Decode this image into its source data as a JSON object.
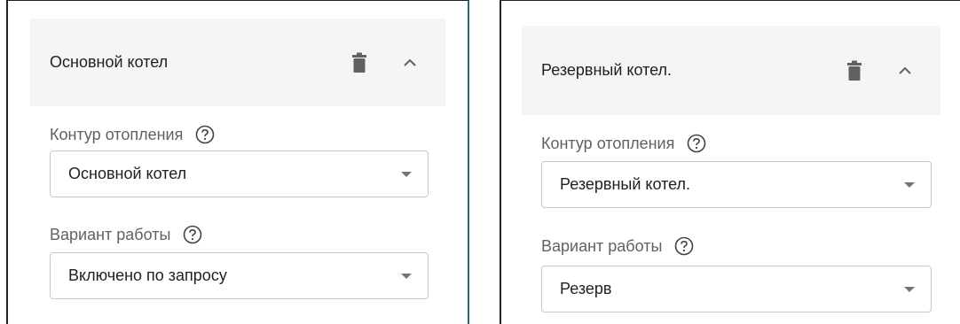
{
  "left_card": {
    "title": "Основной котел",
    "heating_circuit": {
      "label": "Контур отопления",
      "value": "Основной котел"
    },
    "operation_mode": {
      "label": "Вариант работы",
      "value": "Включено по запросу"
    }
  },
  "right_card": {
    "title": "Резервный котел.",
    "heating_circuit": {
      "label": "Контур отопления",
      "value": "Резервный котел."
    },
    "operation_mode": {
      "label": "Вариант работы",
      "value": "Резерв"
    }
  },
  "icons": {
    "delete": "trash-icon",
    "collapse": "chevron-up-icon",
    "help": "help-circle-icon",
    "dropdown": "caret-down-icon"
  },
  "colors": {
    "header_bg": "#f5f5f5",
    "icon": "#616161",
    "border": "#c8c8c8"
  }
}
